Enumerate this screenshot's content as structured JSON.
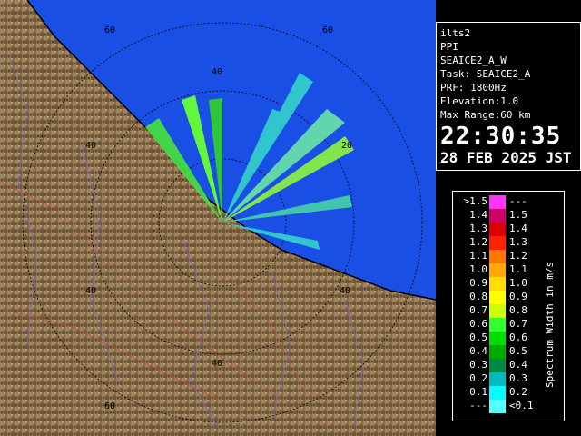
{
  "info": {
    "lines": [
      "ilts2",
      "PPI",
      "SEAICE2_A_W",
      "Task: SEAICE2_A",
      "PRF: 1800Hz",
      "Elevation:1.0",
      "Max Range:60 km"
    ],
    "time": "22:30:35",
    "date": "28 FEB 2025 JST"
  },
  "range_labels": [
    "60",
    "60",
    "40",
    "40",
    "20",
    "40",
    "40",
    "40",
    "60"
  ],
  "legend": {
    "title": "Spectrum Width in m/s",
    "rows": [
      {
        "lo": ">1.5",
        "hi": "---",
        "color": "#ff33ff"
      },
      {
        "lo": "1.4",
        "hi": "1.5",
        "color": "#cc0066"
      },
      {
        "lo": "1.3",
        "hi": "1.4",
        "color": "#dd0000"
      },
      {
        "lo": "1.2",
        "hi": "1.3",
        "color": "#ff2200"
      },
      {
        "lo": "1.1",
        "hi": "1.2",
        "color": "#ff7700"
      },
      {
        "lo": "1.0",
        "hi": "1.1",
        "color": "#ffaa00"
      },
      {
        "lo": "0.9",
        "hi": "1.0",
        "color": "#ffdd00"
      },
      {
        "lo": "0.8",
        "hi": "0.9",
        "color": "#ffff00"
      },
      {
        "lo": "0.7",
        "hi": "0.8",
        "color": "#ccff00"
      },
      {
        "lo": "0.6",
        "hi": "0.7",
        "color": "#33ff33"
      },
      {
        "lo": "0.5",
        "hi": "0.6",
        "color": "#00dd00"
      },
      {
        "lo": "0.4",
        "hi": "0.5",
        "color": "#00aa00"
      },
      {
        "lo": "0.3",
        "hi": "0.4",
        "color": "#008844"
      },
      {
        "lo": "0.2",
        "hi": "0.3",
        "color": "#00bbbb"
      },
      {
        "lo": "0.1",
        "hi": "0.2",
        "color": "#00ffff"
      },
      {
        "lo": "---",
        "hi": "<0.1",
        "color": "#55ffff"
      }
    ]
  },
  "colors": {
    "sea": "#1a4fe6",
    "land": "#8a6e4a",
    "background": "#000000"
  }
}
